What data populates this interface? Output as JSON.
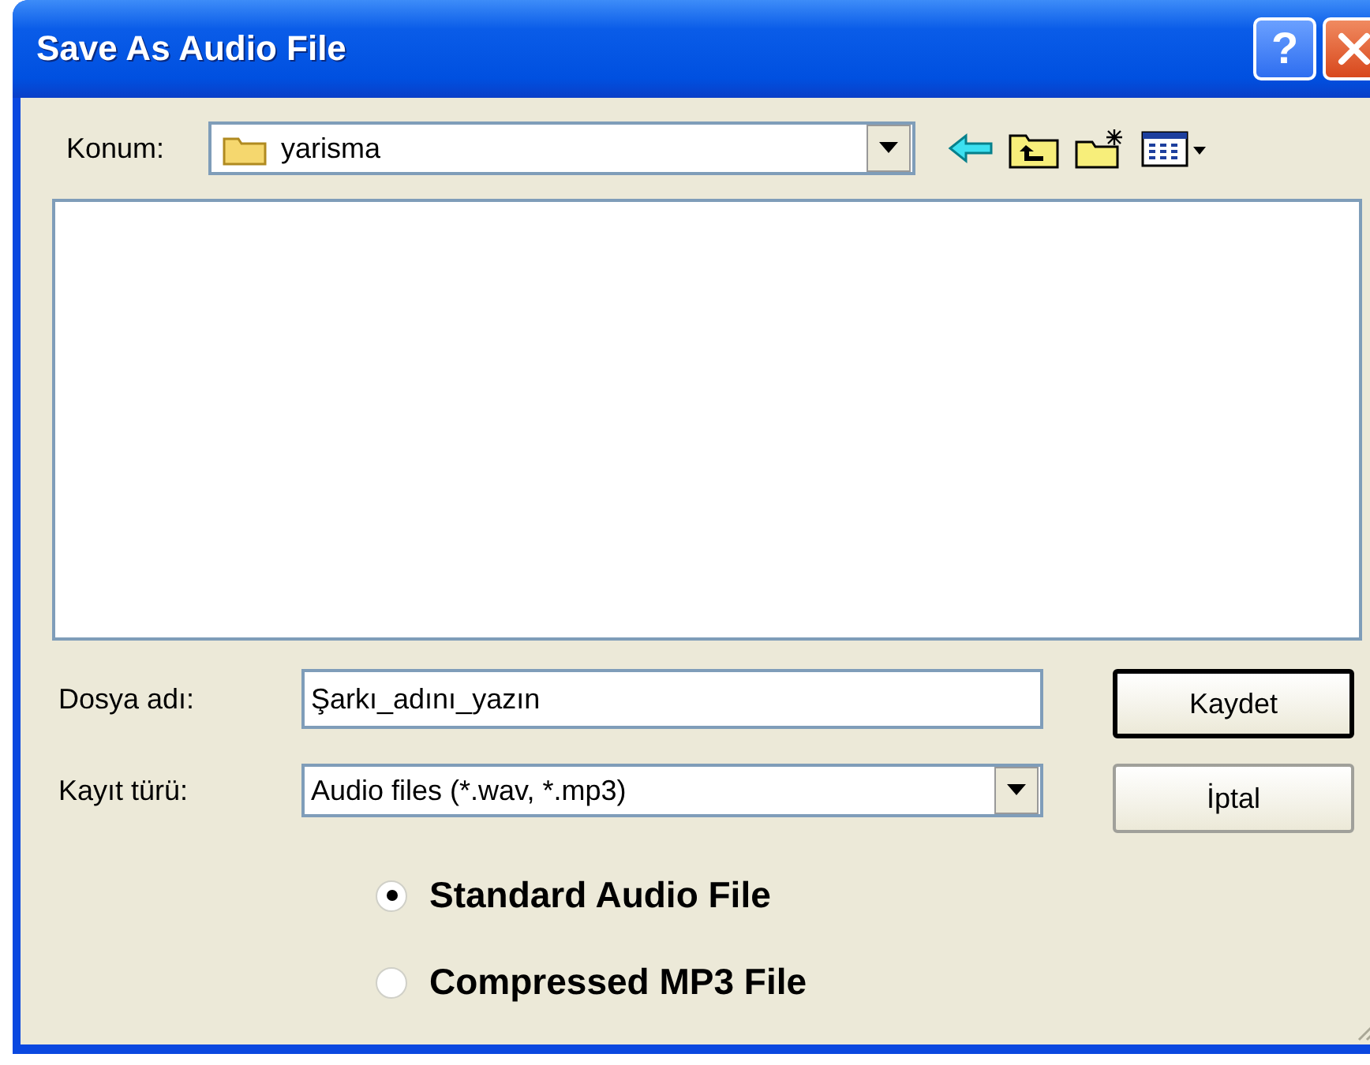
{
  "window": {
    "title": "Save As Audio File"
  },
  "title_buttons": [
    {
      "kind": "help",
      "label": "?"
    },
    {
      "kind": "close"
    }
  ],
  "location": {
    "label": "Konum:",
    "value": "yarisma"
  },
  "toolbar": [
    {
      "kind": "back"
    },
    {
      "kind": "up"
    },
    {
      "kind": "new_folder"
    },
    {
      "kind": "view"
    }
  ],
  "file_name": {
    "label": "Dosya adı:",
    "value": "Şarkı_adını_yazın"
  },
  "file_type": {
    "label": "Kayıt türü:",
    "value": "Audio files (*.wav, *.mp3)"
  },
  "buttons": [
    {
      "label": "Kaydet",
      "default": true
    },
    {
      "label": "İptal",
      "default": false
    }
  ],
  "formats": [
    {
      "label": "Standard Audio File",
      "selected": true
    },
    {
      "label": "Compressed MP3 File",
      "selected": false
    }
  ]
}
